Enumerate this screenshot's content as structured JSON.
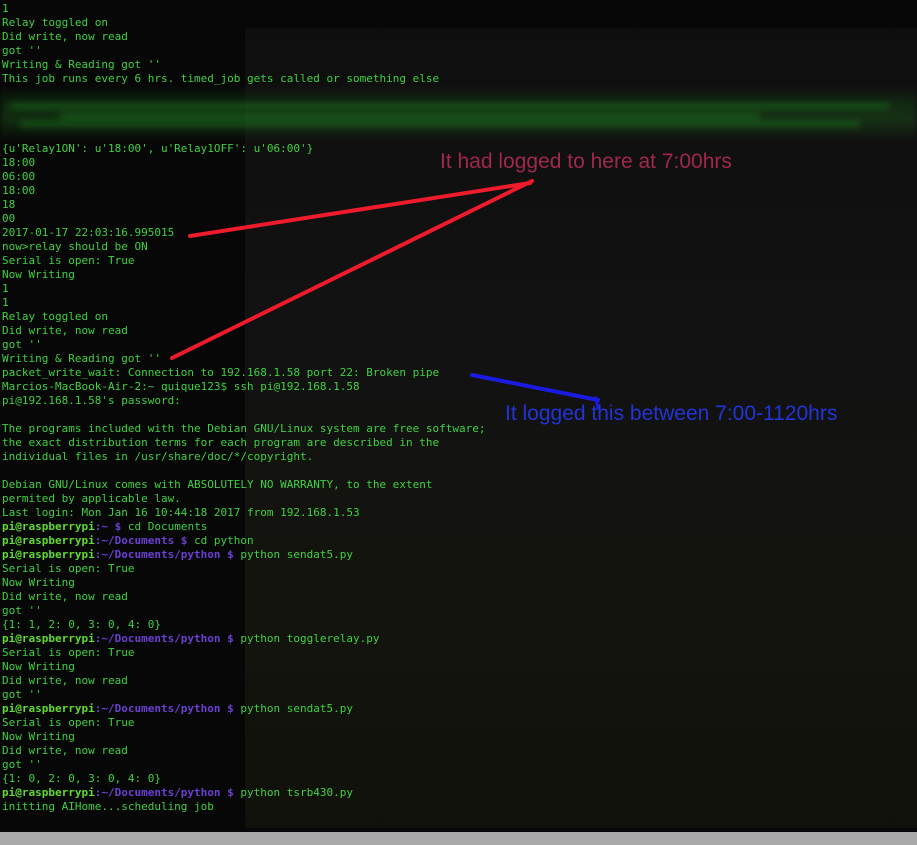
{
  "terminal": {
    "lines": [
      "1",
      "Relay toggled on",
      "Did write, now read",
      "got ''",
      "Writing & Reading got ''",
      "This job runs every 6 hrs. timed_job gets called or something else",
      "",
      "",
      "",
      "",
      "{u'Relay1ON': u'18:00', u'Relay1OFF': u'06:00'}",
      "18:00",
      "06:00",
      "18:00",
      "18",
      "00",
      "2017-01-17 22:03:16.995015",
      "now>relay should be ON",
      "Serial is open: True",
      "Now Writing",
      "1",
      "1",
      "Relay toggled on",
      "Did write, now read",
      "got ''",
      "Writing & Reading got ''",
      "packet_write_wait: Connection to 192.168.1.58 port 22: Broken pipe",
      "Marcios-MacBook-Air-2:~ quique123$ ssh pi@192.168.1.58",
      "pi@192.168.1.58's password:",
      "",
      "The programs included with the Debian GNU/Linux system are free software;",
      "the exact distribution terms for each program are described in the",
      "individual files in /usr/share/doc/*/copyright.",
      "",
      "Debian GNU/Linux comes with ABSOLUTELY NO WARRANTY, to the extent",
      "permited by applicable law.",
      "Last login: Mon Jan 16 10:44:18 2017 from 192.168.1.53"
    ],
    "session": [
      {
        "user": "pi@raspberrypi",
        "path": ":~ $ ",
        "cmd": "cd Documents"
      },
      {
        "user": "pi@raspberrypi",
        "path": ":~/Documents $ ",
        "cmd": "cd python"
      },
      {
        "user": "pi@raspberrypi",
        "path": ":~/Documents/python $ ",
        "cmd": "python sendat5.py"
      },
      {
        "text": "Serial is open: True"
      },
      {
        "text": "Now Writing"
      },
      {
        "text": "Did write, now read"
      },
      {
        "text": "got ''"
      },
      {
        "text": "{1: 1, 2: 0, 3: 0, 4: 0}"
      },
      {
        "user": "pi@raspberrypi",
        "path": ":~/Documents/python $ ",
        "cmd": "python togglerelay.py"
      },
      {
        "text": "Serial is open: True"
      },
      {
        "text": "Now Writing"
      },
      {
        "text": "Did write, now read"
      },
      {
        "text": "got ''"
      },
      {
        "user": "pi@raspberrypi",
        "path": ":~/Documents/python $ ",
        "cmd": "python sendat5.py"
      },
      {
        "text": "Serial is open: True"
      },
      {
        "text": "Now Writing"
      },
      {
        "text": "Did write, now read"
      },
      {
        "text": "got ''"
      },
      {
        "text": "{1: 0, 2: 0, 3: 0, 4: 0}"
      },
      {
        "user": "pi@raspberrypi",
        "path": ":~/Documents/python $ ",
        "cmd": "python tsrb430.py"
      },
      {
        "text": "initting AIHome...scheduling job"
      }
    ]
  },
  "annotations": {
    "first": {
      "text": "It had logged to here at 7:00hrs",
      "color": "#a0284a"
    },
    "second": {
      "text": "It logged this between 7:00-1120hrs",
      "color": "#2333d8"
    },
    "arrow_red": "#ee1b2d",
    "arrow_blue": "#1a1ae0"
  },
  "colors": {
    "text": "#3fd13f",
    "prompt_user": "#5fdb2f",
    "prompt_path": "#6a3fd1",
    "background": "#070707"
  }
}
